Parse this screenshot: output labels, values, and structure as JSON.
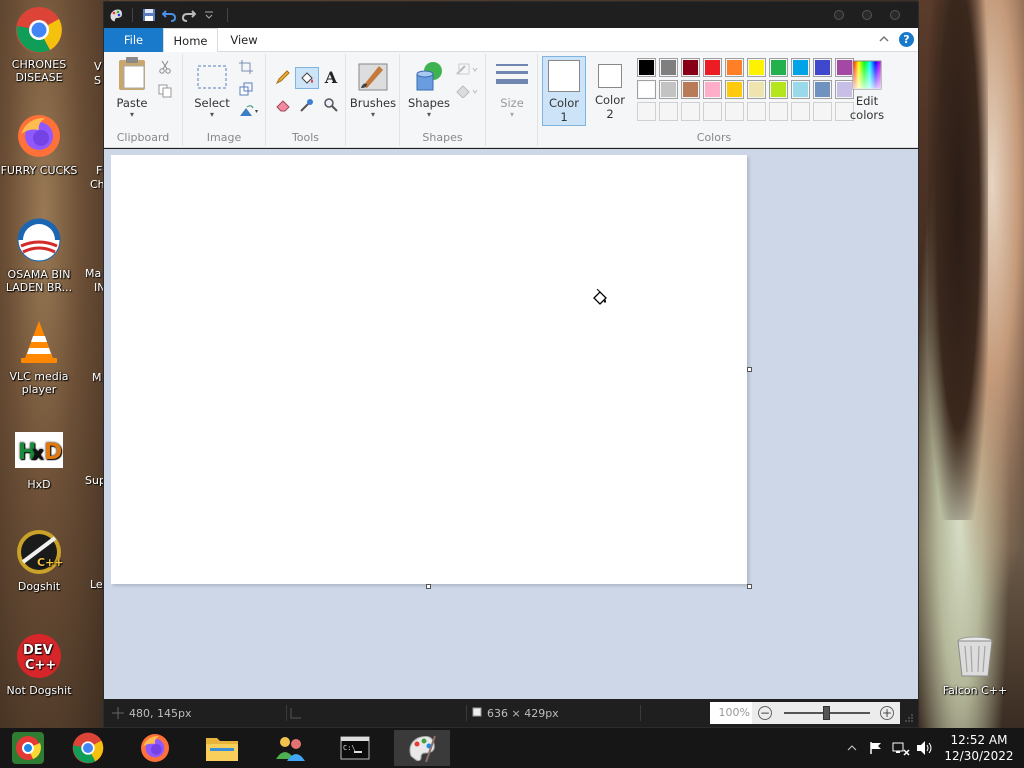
{
  "desktop": {
    "icons": [
      {
        "label": "CHRONES DISEASE",
        "icon": "chrome-icon"
      },
      {
        "label": "FURRY CUCKS",
        "icon": "firefox-icon"
      },
      {
        "label": "OSAMA BIN LADEN BR...",
        "icon": "obama-logo-icon"
      },
      {
        "label": "VLC media player",
        "icon": "vlc-icon"
      },
      {
        "label": "HxD",
        "icon": "hxd-icon"
      },
      {
        "label": "Dogshit",
        "icon": "cpp-icon"
      },
      {
        "label": "Not Dogshit",
        "icon": "devcpp-icon"
      }
    ],
    "partial_labels": [
      "V",
      "S",
      "F",
      "Ch",
      "Ma",
      "IN",
      "M",
      "Sup",
      "Le"
    ],
    "recycle_bin": {
      "label": "Falcon C++",
      "icon": "recycle-bin-icon"
    }
  },
  "window": {
    "app": "Paint",
    "tabs": [
      {
        "label": "File"
      },
      {
        "label": "Home"
      },
      {
        "label": "View"
      }
    ]
  },
  "ribbon": {
    "clipboard": {
      "label": "Clipboard",
      "paste": "Paste"
    },
    "image": {
      "label": "Image",
      "select": "Select"
    },
    "tools": {
      "label": "Tools"
    },
    "brushes": {
      "label": "Brushes"
    },
    "shapes": {
      "label": "Shapes",
      "shapes_btn": "Shapes"
    },
    "size": {
      "label": "Size"
    },
    "colors": {
      "label": "Colors",
      "color1_line1": "Color",
      "color1_line2": "1",
      "color2_line1": "Color",
      "color2_line2": "2",
      "edit_line1": "Edit",
      "edit_line2": "colors",
      "color1_value": "#ffffff",
      "color2_value": "#ffffff",
      "palette_row1": [
        "#000000",
        "#7f7f7f",
        "#880015",
        "#ed1c24",
        "#ff7f27",
        "#fff200",
        "#22b14c",
        "#00a2e8",
        "#3f48cc",
        "#a349a4"
      ],
      "palette_row2": [
        "#ffffff",
        "#c3c3c3",
        "#b97a57",
        "#ffaec9",
        "#ffc90e",
        "#efe4b0",
        "#b5e61d",
        "#99d9ea",
        "#7092be",
        "#c8bfe7"
      ],
      "palette_row3": [
        "#f5f5f5",
        "#f5f5f5",
        "#f5f5f5",
        "#f5f5f5",
        "#f5f5f5",
        "#f5f5f5",
        "#f5f5f5",
        "#f5f5f5",
        "#f5f5f5",
        "#f5f5f5"
      ]
    }
  },
  "statusbar": {
    "cursor_pos": "480, 145px",
    "canvas_size": "636 × 429px",
    "zoom": "100%",
    "zoom_level": 0.5
  },
  "taskbar": {
    "apps": [
      "chrome-alt-icon",
      "chrome-icon",
      "firefox-icon",
      "file-explorer-icon",
      "network-people-icon",
      "cmd-icon",
      "paint-icon"
    ],
    "time": "12:52 AM",
    "date": "12/30/2022"
  }
}
